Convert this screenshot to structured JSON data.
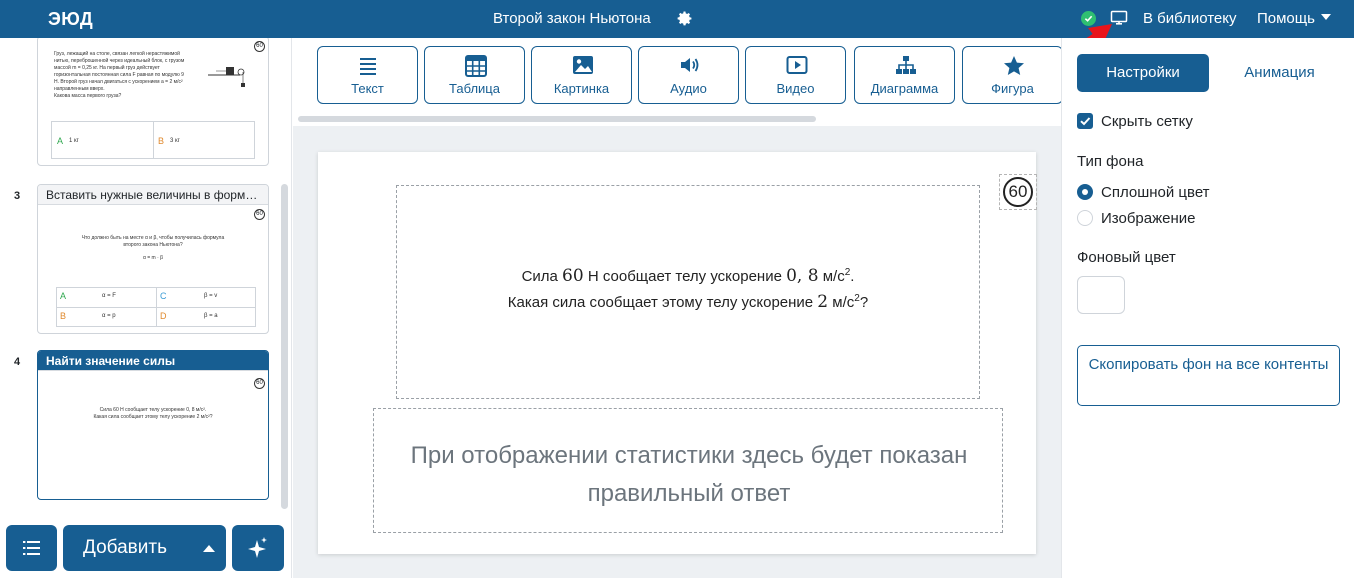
{
  "app": {
    "logo": "ЭЮД",
    "title": "Второй закон Ньютона",
    "to_library": "В библиотеку",
    "help": "Помощь",
    "brand_color": "#175e92"
  },
  "slides": [
    {
      "title": "",
      "timer": "60",
      "text_lines": [
        "Груз, лежащий на столе, связан легкой нерастяжимой",
        "нитью, переброшенной через идеальный блок, с грузом",
        "массой m = 0,25 кг. На первый груз действует",
        "горизонтальная постоянная сила F равная по модулю 9",
        "Н. Второй груз начал двигаться с ускорением a = 2 м/с²",
        "направленным вверх.",
        "Какова масса первого груза?"
      ],
      "answers": [
        {
          "letter": "A",
          "text": "1 кг"
        },
        {
          "letter": "B",
          "text": "3 кг"
        }
      ]
    },
    {
      "number": "3",
      "title": "Вставить нужные величины в формулу",
      "timer": "60",
      "text_lines": [
        "Что должно быть на месте α и β, чтобы получилась формула",
        "второго закона Ньютона?",
        "α = m · β"
      ],
      "answers": [
        {
          "letter": "A",
          "text": "α = F"
        },
        {
          "letter": "C",
          "text": "β = v"
        },
        {
          "letter": "B",
          "text": "α = p"
        },
        {
          "letter": "D",
          "text": "β = a"
        }
      ]
    },
    {
      "number": "4",
      "title": "Найти значение силы",
      "timer": "60",
      "text_lines": [
        "Сила 60 Н сообщает телу ускорение 0, 8 м/с².",
        "Какая сила сообщает этому телу ускорение 2 м/с²?"
      ]
    }
  ],
  "bottom_buttons": {
    "add_label": "Добавить"
  },
  "toolbar": {
    "items": [
      {
        "label": "Текст",
        "icon": "text-lines-icon"
      },
      {
        "label": "Таблица",
        "icon": "table-icon"
      },
      {
        "label": "Картинка",
        "icon": "image-icon"
      },
      {
        "label": "Аудио",
        "icon": "speaker-icon"
      },
      {
        "label": "Видео",
        "icon": "play-icon"
      },
      {
        "label": "Диаграмма",
        "icon": "hierarchy-icon"
      },
      {
        "label": "Фигура",
        "icon": "star-icon"
      }
    ]
  },
  "canvas": {
    "timer": "60",
    "question": {
      "line1_pre": "Сила ",
      "line1_num1": "60",
      "line1_mid": " Н сообщает телу ускорение ",
      "line1_num2": "0, 8",
      "line1_unit": " м/с",
      "line1_end": ".",
      "line2_pre": "Какая сила сообщает этому телу ускорение ",
      "line2_num": "2",
      "line2_unit": " м/с",
      "line2_end": "?",
      "exp": "2"
    },
    "answer_placeholder": "При отображении статистики здесь будет показан правильный ответ"
  },
  "settings": {
    "tab_settings": "Настройки",
    "tab_animation": "Анимация",
    "hide_grid_label": "Скрыть сетку",
    "hide_grid_checked": true,
    "background_type_label": "Тип фона",
    "bg_option_solid": "Сплошной цвет",
    "bg_option_image": "Изображение",
    "bg_selected": "Сплошной цвет",
    "bg_color_label": "Фоновый цвет",
    "bg_color_value": "#ffffff",
    "copy_bg_button": "Скопировать фон на все контенты"
  }
}
